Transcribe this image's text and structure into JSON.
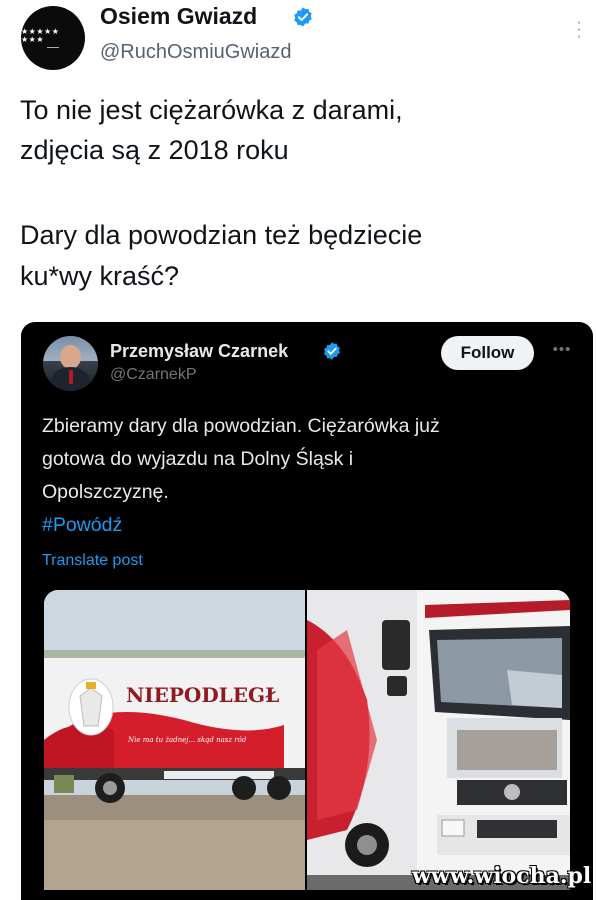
{
  "outer_tweet": {
    "avatar_text": "★★★★★ ★★★",
    "display_name": "Osiem Gwiazd",
    "handle": "@RuchOsmiuGwiazd",
    "text_lines": [
      "To nie jest ciężarówka z darami,",
      "zdjęcia są z 2018 roku",
      "Dary dla powodzian też będziecie",
      "ku*wy kraść?"
    ]
  },
  "quoted_post": {
    "display_name": "Przemysław Czarnek",
    "handle": "@CzarnekP",
    "follow_label": "Follow",
    "menu_label": "•••",
    "text_lines": [
      "Zbieramy dary dla powodzian. Ciężarówka już",
      "gotowa do wyjazdu na Dolny Śląsk i",
      "Opolszczyznę."
    ],
    "hashtag": "#Powódź",
    "translate_label": "Translate post",
    "photo_left": {
      "trailer_text": "NIEPODLEGŁ",
      "slogan": "Nie ma tu żadnej... skąd nasz ród"
    }
  },
  "watermark": "www.wiocha.pl",
  "colors": {
    "verified": "#1d9bf0",
    "link": "#1d9bf0",
    "dark_bg": "#000000"
  }
}
